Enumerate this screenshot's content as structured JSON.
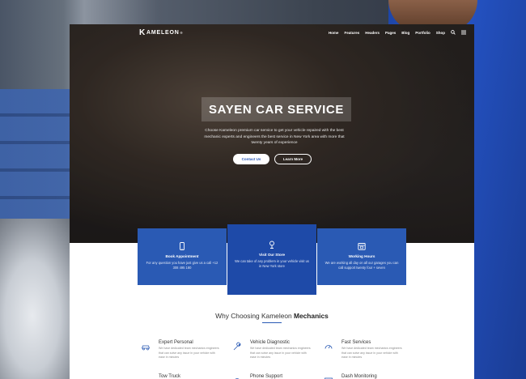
{
  "site": {
    "logo": {
      "mark": "K",
      "text": "AMELEON",
      "sup": "®"
    },
    "nav": [
      "Home",
      "Features",
      "Headers",
      "Pages",
      "Blog",
      "Portfolio",
      "Shop"
    ],
    "nav_icons": [
      "search-icon",
      "menu-icon"
    ]
  },
  "hero": {
    "title": "SAYEN CAR SERVICE",
    "subtitle": "Choose Kameleon premium car service to get your vehicle repaired with the best mechanic experts and engineers the best service in New York area with more that twenty years of experience",
    "contact_button": "Contact Us",
    "learn_button": "Learn More"
  },
  "features": [
    {
      "icon": "phone-icon",
      "title": "Book Appointment",
      "desc": "For any question you have just give us a call +12 308 495 180"
    },
    {
      "icon": "location-icon",
      "title": "Visit Our Store",
      "desc": "We can take of any problem in your vehicle visit us in New York store"
    },
    {
      "icon": "calendar-icon",
      "title": "Working Hours",
      "desc": "We are working all day on all our garages you can call support twenty four + seven"
    }
  ],
  "why": {
    "title_prefix": "Why Choosing Kameleon ",
    "title_strong": "Mechanics"
  },
  "services": [
    {
      "icon": "car-icon",
      "title": "Expert Personal",
      "desc": "We have dedicated team mechanics engineers that can solve any issue in your vehicle with ease in minutes"
    },
    {
      "icon": "wrench-icon",
      "title": "Vehicle Diagnostic",
      "desc": "We have dedicated team mechanics engineers that can solve any issue in your vehicle with ease in minutes"
    },
    {
      "icon": "gauge-icon",
      "title": "Fast Services",
      "desc": "We have dedicated team mechanics engineers that can solve any issue in your vehicle with ease in minutes"
    },
    {
      "icon": "tow-truck-icon",
      "title": "Tow Truck",
      "desc": ""
    },
    {
      "icon": "headset-icon",
      "title": "Phone Support",
      "desc": ""
    },
    {
      "icon": "monitor-icon",
      "title": "Dash Monitoring",
      "desc": ""
    }
  ],
  "colors": {
    "accent": "#2a5ab4",
    "accent_dark": "#1e4aa8",
    "worker_blue": "#2452c2"
  }
}
